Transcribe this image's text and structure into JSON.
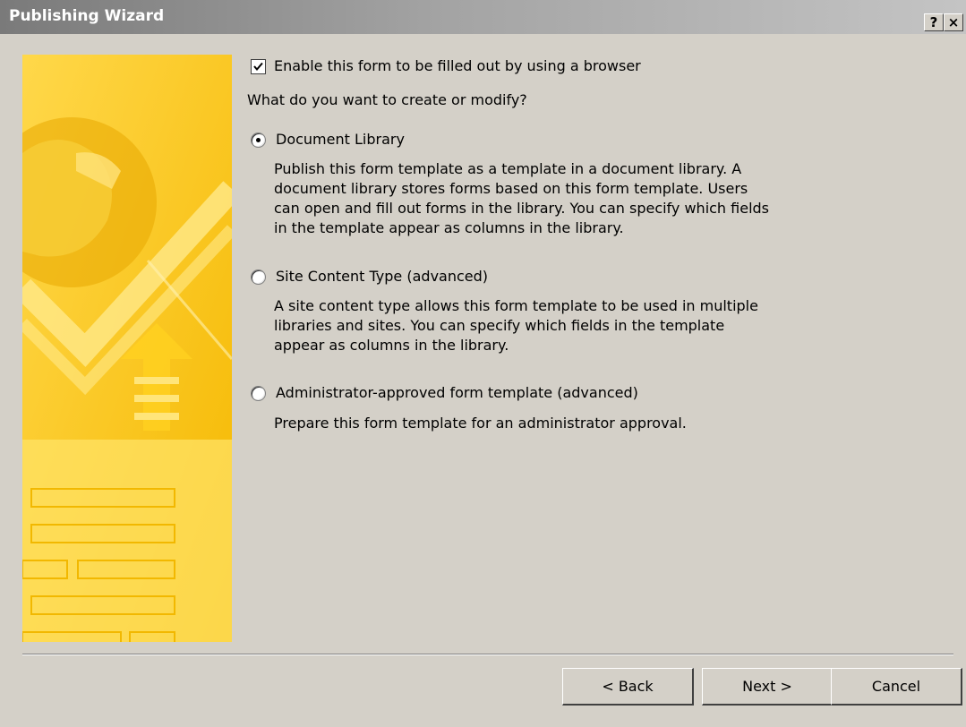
{
  "window": {
    "title": "Publishing Wizard",
    "help_label": "?",
    "close_label": "×"
  },
  "form": {
    "browser_checkbox_label": "Enable this form to be filled out by using a browser",
    "browser_checkbox_checked": true,
    "question": "What do you want to create or modify?",
    "selected_option": "Document Library",
    "options": [
      {
        "label": "Document Library",
        "selected": true,
        "description": [
          "Publish this form template as a template in a document library. A",
          "document library stores forms based on this form template. Users",
          "can open and fill out forms in the library. You can specify which fields",
          "in the template appear as columns in the library."
        ]
      },
      {
        "label": "Site Content Type (advanced)",
        "selected": false,
        "description": [
          "A site content type allows this form template to be used in multiple",
          "libraries and sites. You can specify which fields in the template",
          "appear as columns in the library."
        ]
      },
      {
        "label": "Administrator-approved form template (advanced)",
        "selected": false,
        "description": [
          "Prepare this form template for an administrator approval."
        ]
      }
    ]
  },
  "buttons": {
    "back": "< Back",
    "next": "Next >",
    "cancel": "Cancel"
  },
  "colors": {
    "banner_yellow": "#f8c400",
    "dialog_gray": "#d4d0c8"
  },
  "icons": {
    "banner": "office-wizard-banner-art"
  }
}
